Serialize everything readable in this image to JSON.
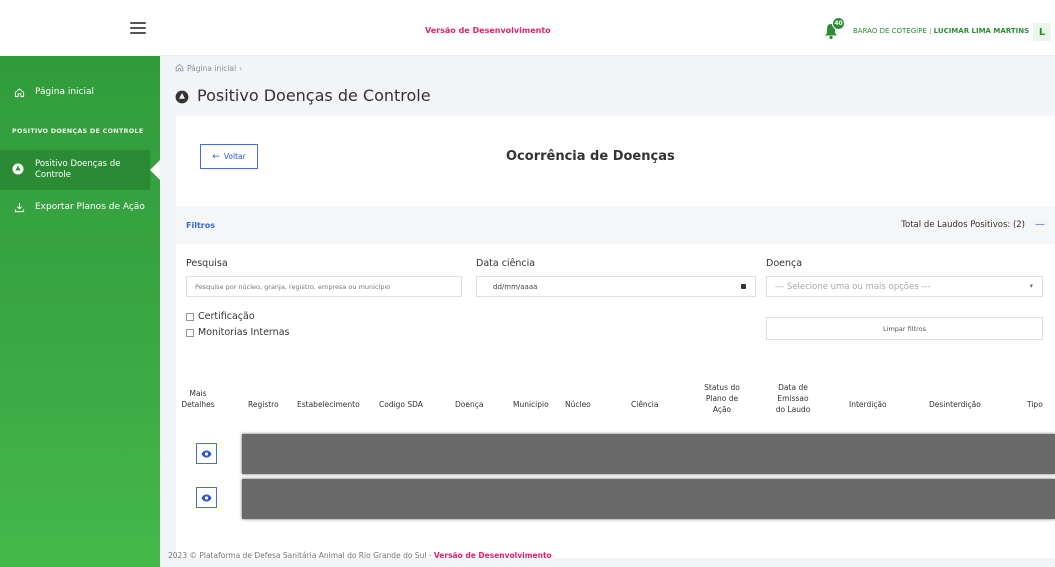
{
  "topbar": {
    "environment_label": "Versão de Desenvolvimento",
    "notification_count": "40",
    "location": "BARAO DE COTEGIPE",
    "separator": "|",
    "user_name": "LUCIMAR LIMA MARTINS",
    "avatar_letter": "L"
  },
  "sidebar": {
    "home_label": "Página inicial",
    "section_label": "POSITIVO DOENÇAS DE CONTROLE",
    "active_item_label": "Positivo Doenças de Controle",
    "export_label": "Exportar Planos de Ação"
  },
  "breadcrumb": {
    "home": "Página inicial",
    "separator": "›"
  },
  "page_title": "Positivo Doenças de Controle",
  "card": {
    "back_label": "Voltar",
    "title": "Ocorrência de Doenças"
  },
  "filters": {
    "label": "Filtros",
    "total_label": "Total de Laudos Positivos: (2)",
    "collapse_icon": "—",
    "search_label": "Pesquisa",
    "search_placeholder": "Pesquise por núcleo, granja, registro, empresa ou município",
    "date_label": "Data ciência",
    "date_placeholder": "dd/mm/aaaa",
    "disease_label": "Doença",
    "disease_placeholder": "--- Selecione uma ou mais opções ---",
    "certification_label": "Certificação",
    "internal_monitoring_label": "Monitorias Internas",
    "clear_label": "Limpar filtros"
  },
  "table": {
    "headers": {
      "details": [
        "Mais",
        "Detalhes"
      ],
      "registro": "Registro",
      "estabelecimento": "Estabelecimento",
      "codigo_sda": "Codigo SDA",
      "doenca": "Doença",
      "municipio": "Municipio",
      "nucleo": "Núcleo",
      "ciencia": "Ciência",
      "status": [
        "Status do",
        "Plano de",
        "Ação"
      ],
      "data_emissao": [
        "Data de",
        "Emissao",
        "do Laudo"
      ],
      "interdicao": "Interdição",
      "desinterdicao": "Desinterdição",
      "tipo": "Tipo"
    },
    "row_count": 2
  },
  "footer": {
    "text": "2023 © Plataforma de Defesa Sanitária Animal do Rio Grande do Sul -",
    "dev_label": "Versão de Desenvolvimento"
  },
  "colors": {
    "sidebar_green": "#3aa543",
    "accent_blue": "#3a64d8",
    "dev_pink": "#e0246a"
  }
}
